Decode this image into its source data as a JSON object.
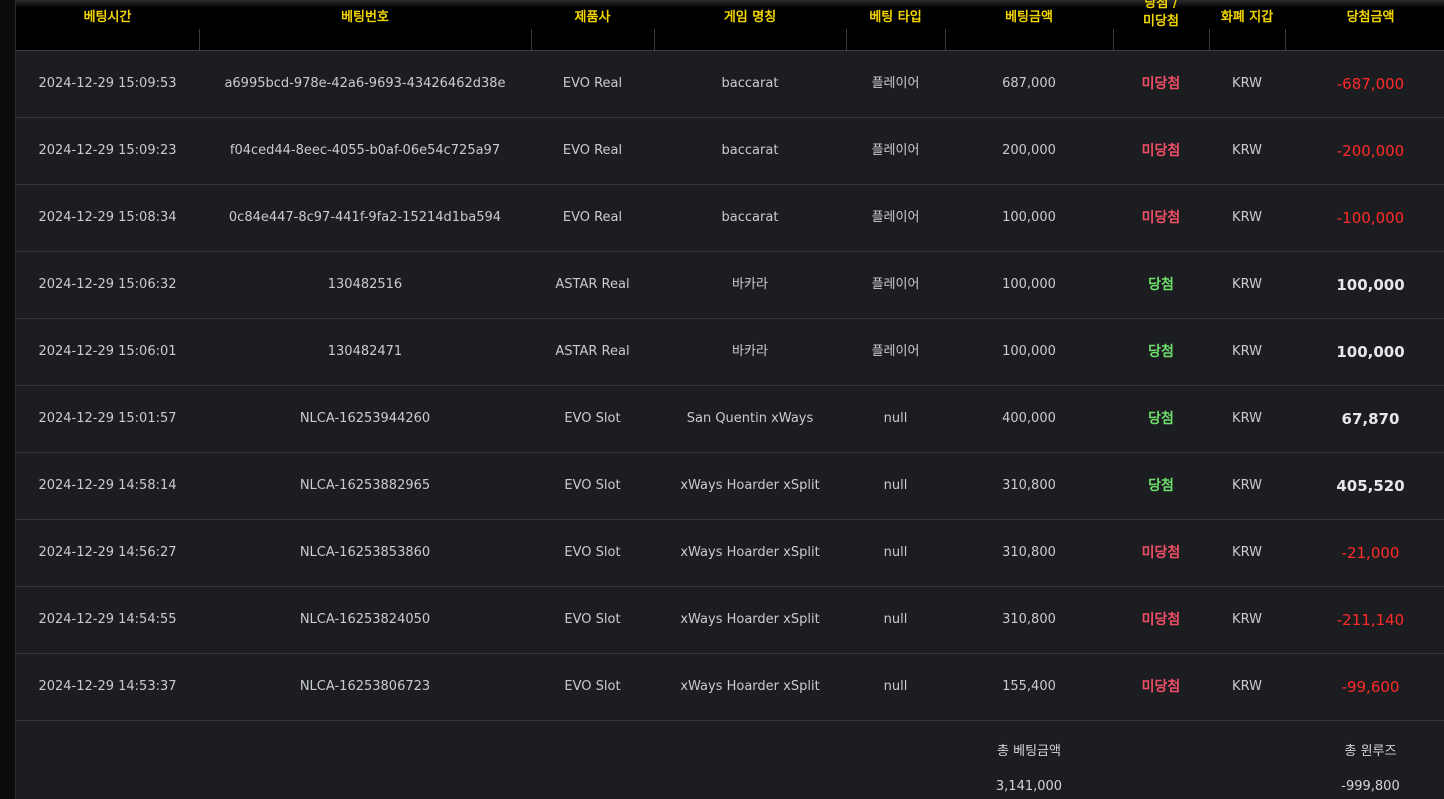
{
  "colors": {
    "header_text": "#f2d400",
    "lose": "#ee4f67",
    "win": "#6ddd6b",
    "negative_amount": "#ff2a2a"
  },
  "headers": {
    "bet_time": "베팅시간",
    "bet_id": "베팅번호",
    "provider": "제품사",
    "game_name": "게임 명칭",
    "bet_type": "베팅 타입",
    "bet_amount": "베팅금액",
    "result_line1": "당첨 /",
    "result_line2": "미당첨",
    "currency": "화폐 지갑",
    "win_amount": "당첨금액"
  },
  "rows": [
    {
      "time": "2024-12-29 15:09:53",
      "id": "a6995bcd-978e-42a6-9693-43426462d38e",
      "provider": "EVO Real",
      "game": "baccarat",
      "type": "플레이어",
      "bet": "687,000",
      "result": "미당첨",
      "currency": "KRW",
      "win": "-687,000"
    },
    {
      "time": "2024-12-29 15:09:23",
      "id": "f04ced44-8eec-4055-b0af-06e54c725a97",
      "provider": "EVO Real",
      "game": "baccarat",
      "type": "플레이어",
      "bet": "200,000",
      "result": "미당첨",
      "currency": "KRW",
      "win": "-200,000"
    },
    {
      "time": "2024-12-29 15:08:34",
      "id": "0c84e447-8c97-441f-9fa2-15214d1ba594",
      "provider": "EVO Real",
      "game": "baccarat",
      "type": "플레이어",
      "bet": "100,000",
      "result": "미당첨",
      "currency": "KRW",
      "win": "-100,000"
    },
    {
      "time": "2024-12-29 15:06:32",
      "id": "130482516",
      "provider": "ASTAR Real",
      "game": "바카라",
      "type": "플레이어",
      "bet": "100,000",
      "result": "당첨",
      "currency": "KRW",
      "win": "100,000"
    },
    {
      "time": "2024-12-29 15:06:01",
      "id": "130482471",
      "provider": "ASTAR Real",
      "game": "바카라",
      "type": "플레이어",
      "bet": "100,000",
      "result": "당첨",
      "currency": "KRW",
      "win": "100,000"
    },
    {
      "time": "2024-12-29 15:01:57",
      "id": "NLCA-16253944260",
      "provider": "EVO Slot",
      "game": "San Quentin xWays",
      "type": "null",
      "bet": "400,000",
      "result": "당첨",
      "currency": "KRW",
      "win": "67,870"
    },
    {
      "time": "2024-12-29 14:58:14",
      "id": "NLCA-16253882965",
      "provider": "EVO Slot",
      "game": "xWays Hoarder xSplit",
      "type": "null",
      "bet": "310,800",
      "result": "당첨",
      "currency": "KRW",
      "win": "405,520"
    },
    {
      "time": "2024-12-29 14:56:27",
      "id": "NLCA-16253853860",
      "provider": "EVO Slot",
      "game": "xWays Hoarder xSplit",
      "type": "null",
      "bet": "310,800",
      "result": "미당첨",
      "currency": "KRW",
      "win": "-21,000"
    },
    {
      "time": "2024-12-29 14:54:55",
      "id": "NLCA-16253824050",
      "provider": "EVO Slot",
      "game": "xWays Hoarder xSplit",
      "type": "null",
      "bet": "310,800",
      "result": "미당첨",
      "currency": "KRW",
      "win": "-211,140"
    },
    {
      "time": "2024-12-29 14:53:37",
      "id": "NLCA-16253806723",
      "provider": "EVO Slot",
      "game": "xWays Hoarder xSplit",
      "type": "null",
      "bet": "155,400",
      "result": "미당첨",
      "currency": "KRW",
      "win": "-99,600"
    }
  ],
  "footer": {
    "total_bet_label": "총 베팅금액",
    "total_bet_value": "3,141,000",
    "total_winloss_label": "총 윈루즈",
    "total_winloss_value": "-999,800"
  }
}
